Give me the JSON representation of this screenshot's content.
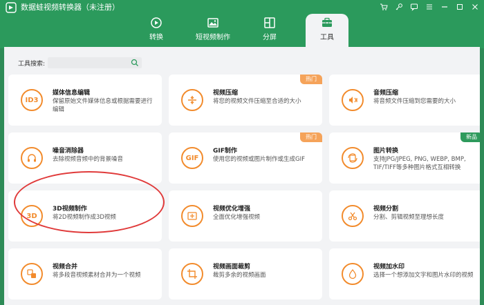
{
  "app": {
    "title": "数据蛙视频转换器（未注册）"
  },
  "colors": {
    "accent": "#2b9a5c",
    "icon": "#f28b2c",
    "hot": "#f5a35a",
    "new": "#2e9a5c",
    "annotation": "#e03a3a"
  },
  "window_buttons": [
    "cart-icon",
    "key-icon",
    "feedback-icon",
    "menu-icon",
    "minimize-icon",
    "maximize-icon",
    "close-icon"
  ],
  "tabs": [
    {
      "label": "转换",
      "icon": "convert-icon",
      "active": false
    },
    {
      "label": "短视频制作",
      "icon": "image-icon",
      "active": false
    },
    {
      "label": "分屏",
      "icon": "split-screen-icon",
      "active": false
    },
    {
      "label": "工具",
      "icon": "toolbox-icon",
      "active": true
    }
  ],
  "search": {
    "label": "工具搜索:",
    "value": "",
    "placeholder": ""
  },
  "tools": [
    {
      "title": "媒体信息编辑",
      "desc": "保留原始文件媒体信息或根据需要进行编辑",
      "icon": "ID3",
      "badge": ""
    },
    {
      "title": "视频压缩",
      "desc": "将您的视频文件压缩至合适的大小",
      "icon": "compress-icon",
      "badge": "热门"
    },
    {
      "title": "音频压缩",
      "desc": "将音频文件压缩到您需要的大小",
      "icon": "audio-compress-icon",
      "badge": ""
    },
    {
      "title": "噪音消除器",
      "desc": "去除视频音频中的背景噪音",
      "icon": "headphone-icon",
      "badge": ""
    },
    {
      "title": "GIF制作",
      "desc": "使用您的视频或图片制作或生成GIF",
      "icon": "GIF",
      "badge": "热门"
    },
    {
      "title": "图片转换",
      "desc": "支持JPG/JPEG, PNG, WEBP, BMP, TIF/TIFF等多种图片格式互相转换",
      "icon": "image-convert-icon",
      "badge": "新品"
    },
    {
      "title": "3D视频制作",
      "desc": "将2D视频制作成3D视频",
      "icon": "3D",
      "badge": ""
    },
    {
      "title": "视频优化增强",
      "desc": "全面优化增强视频",
      "icon": "enhance-icon",
      "badge": ""
    },
    {
      "title": "视频分割",
      "desc": "分割、剪辑视频至理想长度",
      "icon": "scissors-icon",
      "badge": ""
    },
    {
      "title": "视频合并",
      "desc": "将多段音视频素材合并为一个视频",
      "icon": "merge-icon",
      "badge": ""
    },
    {
      "title": "视频画面裁剪",
      "desc": "裁剪多余的视频画面",
      "icon": "crop-icon",
      "badge": ""
    },
    {
      "title": "视频加水印",
      "desc": "选择一个想添加文字和图片水印的视频",
      "icon": "watermark-icon",
      "badge": ""
    }
  ]
}
